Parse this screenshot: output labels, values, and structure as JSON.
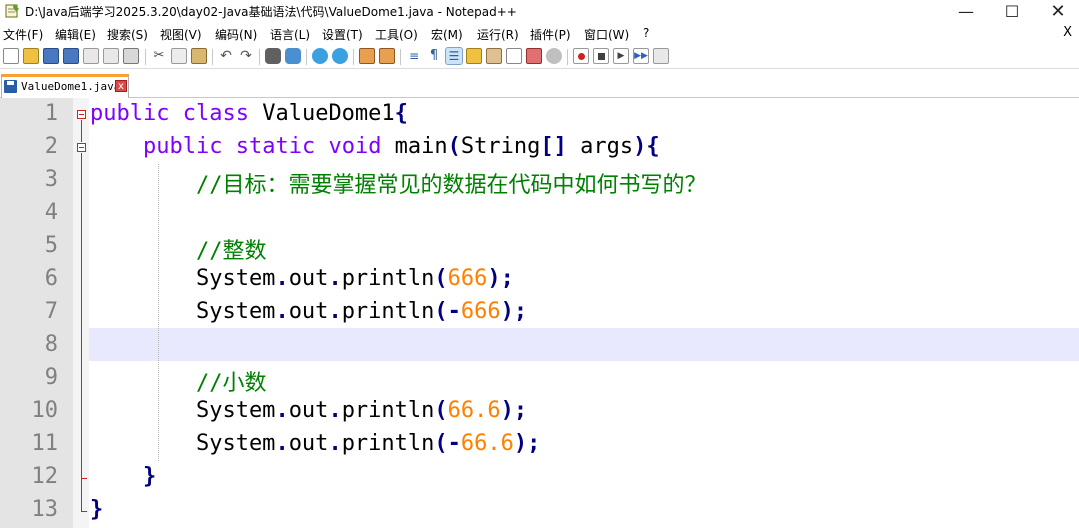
{
  "window": {
    "title": "D:\\Java后端学习2025.3.20\\day02-Java基础语法\\代码\\ValueDome1.java - Notepad++",
    "minimize_glyph": "—",
    "maximize_glyph": "☐",
    "close_glyph": "✕",
    "app_icon": "notepad-icon"
  },
  "menu": {
    "items": [
      "文件(F)",
      "编辑(E)",
      "搜索(S)",
      "视图(V)",
      "编码(N)",
      "语言(L)",
      "设置(T)",
      "工具(O)",
      "宏(M)",
      "运行(R)",
      "插件(P)",
      "窗口(W)",
      "?"
    ],
    "close_glyph": "X"
  },
  "toolbar": {
    "icons": [
      "new-file-icon",
      "open-file-icon",
      "save-icon",
      "save-all-icon",
      "close-icon",
      "close-all-icon",
      "print-icon",
      "cut-icon",
      "copy-icon",
      "paste-icon",
      "undo-icon",
      "redo-icon",
      "find-icon",
      "replace-icon",
      "zoom-in-icon",
      "zoom-out-icon",
      "sync-vertical-icon",
      "sync-horizontal-icon",
      "word-wrap-icon",
      "show-all-chars-icon",
      "indent-guide-icon",
      "udl-icon",
      "doc-map-icon",
      "function-list-icon",
      "folder-workspace-icon",
      "monitoring-icon",
      "record-macro-icon",
      "stop-macro-icon",
      "play-macro-icon",
      "run-macro-multiple-icon",
      "save-macro-icon"
    ]
  },
  "tab": {
    "label": "ValueDome1.java",
    "close_glyph": "x"
  },
  "editor": {
    "current_line": 8,
    "lines": [
      {
        "n": "1",
        "tokens": [
          {
            "t": "public",
            "c": "kw"
          },
          {
            "t": " ",
            "c": ""
          },
          {
            "t": "class",
            "c": "kw"
          },
          {
            "t": " ValueDome1",
            "c": ""
          },
          {
            "t": "{",
            "c": "op"
          }
        ]
      },
      {
        "n": "2",
        "tokens": [
          {
            "t": "    ",
            "c": ""
          },
          {
            "t": "public",
            "c": "kw"
          },
          {
            "t": " ",
            "c": ""
          },
          {
            "t": "static",
            "c": "kw"
          },
          {
            "t": " ",
            "c": ""
          },
          {
            "t": "void",
            "c": "kw"
          },
          {
            "t": " main",
            "c": ""
          },
          {
            "t": "(",
            "c": "op"
          },
          {
            "t": "String",
            "c": ""
          },
          {
            "t": "[]",
            "c": "op"
          },
          {
            "t": " args",
            "c": ""
          },
          {
            "t": "){",
            "c": "op"
          }
        ]
      },
      {
        "n": "3",
        "tokens": [
          {
            "t": "        ",
            "c": ""
          },
          {
            "t": "//目标：需要掌握常见的数据在代码中如何书写的？",
            "c": "cmt"
          }
        ]
      },
      {
        "n": "4",
        "tokens": []
      },
      {
        "n": "5",
        "tokens": [
          {
            "t": "        ",
            "c": ""
          },
          {
            "t": "//整数",
            "c": "cmt"
          }
        ]
      },
      {
        "n": "6",
        "tokens": [
          {
            "t": "        System",
            "c": ""
          },
          {
            "t": ".",
            "c": "op"
          },
          {
            "t": "out",
            "c": ""
          },
          {
            "t": ".",
            "c": "op"
          },
          {
            "t": "println",
            "c": ""
          },
          {
            "t": "(",
            "c": "op"
          },
          {
            "t": "666",
            "c": "num"
          },
          {
            "t": ");",
            "c": "op"
          }
        ]
      },
      {
        "n": "7",
        "tokens": [
          {
            "t": "        System",
            "c": ""
          },
          {
            "t": ".",
            "c": "op"
          },
          {
            "t": "out",
            "c": ""
          },
          {
            "t": ".",
            "c": "op"
          },
          {
            "t": "println",
            "c": ""
          },
          {
            "t": "(-",
            "c": "op"
          },
          {
            "t": "666",
            "c": "num"
          },
          {
            "t": ");",
            "c": "op"
          }
        ]
      },
      {
        "n": "8",
        "tokens": []
      },
      {
        "n": "9",
        "tokens": [
          {
            "t": "        ",
            "c": ""
          },
          {
            "t": "//小数",
            "c": "cmt"
          }
        ]
      },
      {
        "n": "10",
        "tokens": [
          {
            "t": "        System",
            "c": ""
          },
          {
            "t": ".",
            "c": "op"
          },
          {
            "t": "out",
            "c": ""
          },
          {
            "t": ".",
            "c": "op"
          },
          {
            "t": "println",
            "c": ""
          },
          {
            "t": "(",
            "c": "op"
          },
          {
            "t": "66.6",
            "c": "num"
          },
          {
            "t": ");",
            "c": "op"
          }
        ]
      },
      {
        "n": "11",
        "tokens": [
          {
            "t": "        System",
            "c": ""
          },
          {
            "t": ".",
            "c": "op"
          },
          {
            "t": "out",
            "c": ""
          },
          {
            "t": ".",
            "c": "op"
          },
          {
            "t": "println",
            "c": ""
          },
          {
            "t": "(-",
            "c": "op"
          },
          {
            "t": "66.6",
            "c": "num"
          },
          {
            "t": ");",
            "c": "op"
          }
        ]
      },
      {
        "n": "12",
        "tokens": [
          {
            "t": "    ",
            "c": ""
          },
          {
            "t": "}",
            "c": "op"
          }
        ]
      },
      {
        "n": "13",
        "tokens": [
          {
            "t": "}",
            "c": "op"
          }
        ]
      }
    ]
  },
  "colors": {
    "keyword": "#8000ff",
    "operator": "#000080",
    "number": "#ff8000",
    "comment": "#008000",
    "current_line": "#e8e8ff",
    "tab_accent": "#f8a030"
  }
}
